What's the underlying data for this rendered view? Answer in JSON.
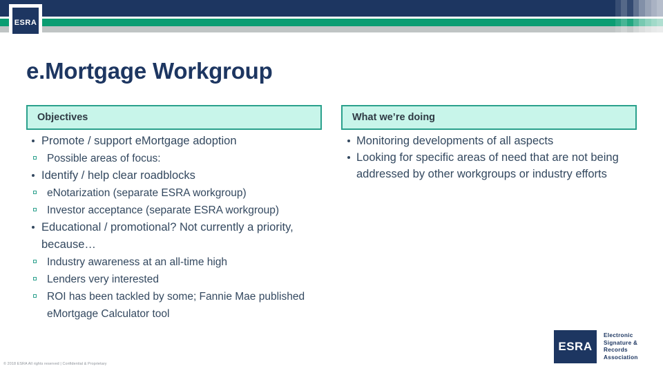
{
  "banner": {
    "navy_color": "#1d3661",
    "green_color": "#0a9d72",
    "gray_color": "#bfc4c4",
    "stripe_opacities": [
      0.0,
      0.12,
      0.25,
      0.1,
      0.3,
      0.45,
      0.55,
      0.62,
      0.68
    ]
  },
  "logo_top": {
    "label": "ESRA"
  },
  "title": "e.Mortgage Workgroup",
  "columns": {
    "objectives": {
      "header": "Objectives",
      "items": [
        {
          "level": 1,
          "text": "Promote / support eMortgage adoption"
        },
        {
          "level": 2,
          "text": "Possible areas of focus:"
        },
        {
          "level": 1,
          "text": "Identify / help clear roadblocks"
        },
        {
          "level": 2,
          "text": "eNotarization (separate ESRA workgroup)"
        },
        {
          "level": 2,
          "text": "Investor acceptance (separate ESRA workgroup)"
        },
        {
          "level": 1,
          "text": "Educational / promotional? Not currently a priority, because…"
        },
        {
          "level": 2,
          "text": "Industry awareness at an all-time high"
        },
        {
          "level": 2,
          "text": "Lenders very interested"
        },
        {
          "level": 2,
          "text": "ROI has been tackled by some; Fannie Mae published eMortgage Calculator tool"
        }
      ]
    },
    "doing": {
      "header": "What we’re doing",
      "items": [
        {
          "level": 1,
          "text": "Monitoring developments of all aspects"
        },
        {
          "level": 1,
          "text": "Looking for specific areas of need that are not being addressed by other workgroups or industry efforts"
        }
      ]
    }
  },
  "logo_lockup": {
    "mark_label": "ESRA",
    "line1": "Electronic",
    "line2": "Signature &",
    "line3": "Records",
    "line4": "Association"
  },
  "footer": "© 2018 ESRA All rights reserved |  Confidential & Proprietary",
  "accent_colors": {
    "navy": "#1d3661",
    "green": "#0a9d72",
    "teal_border": "#2aa08c",
    "mint_fill": "#c8f5ea",
    "body_text": "#33485f"
  }
}
